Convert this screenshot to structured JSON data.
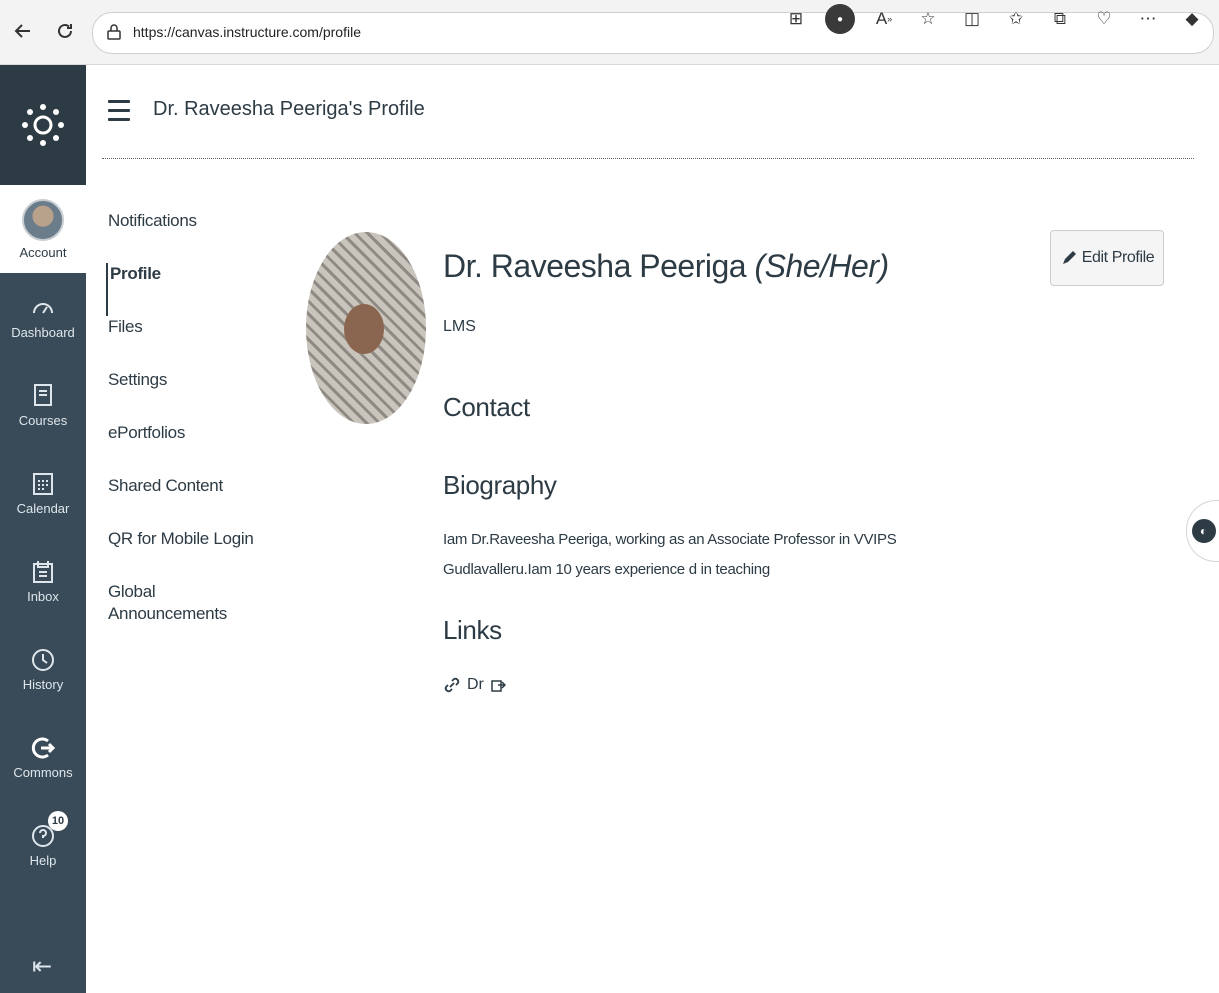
{
  "browser": {
    "url": "https://canvas.instructure.com/profile",
    "toolbar_icons": [
      "grid-icon",
      "avatar-icon",
      "read-aloud-icon",
      "favorite-star-icon",
      "split-screen-icon",
      "favorites-list-icon",
      "collections-icon",
      "browser-essentials-icon",
      "more-icon",
      "copilot-icon"
    ]
  },
  "global_nav": {
    "items": [
      {
        "label": "Account",
        "icon": "account-avatar"
      },
      {
        "label": "Dashboard",
        "icon": "dashboard-icon"
      },
      {
        "label": "Courses",
        "icon": "courses-icon"
      },
      {
        "label": "Calendar",
        "icon": "calendar-icon"
      },
      {
        "label": "Inbox",
        "icon": "inbox-icon"
      },
      {
        "label": "History",
        "icon": "history-icon"
      },
      {
        "label": "Commons",
        "icon": "commons-icon"
      },
      {
        "label": "Help",
        "icon": "help-icon",
        "badge": "10"
      }
    ]
  },
  "header": {
    "title": "Dr. Raveesha Peeriga's Profile"
  },
  "subnav": {
    "items": [
      {
        "label": "Notifications"
      },
      {
        "label": "Profile"
      },
      {
        "label": "Files"
      },
      {
        "label": "Settings"
      },
      {
        "label": "ePortfolios"
      },
      {
        "label": "Shared Content"
      },
      {
        "label": "QR for Mobile Login"
      },
      {
        "label": "Global Announcements"
      }
    ]
  },
  "profile": {
    "name": "Dr. Raveesha Peeriga",
    "pronouns": "(She/Her)",
    "title": "LMS",
    "edit_label": "Edit Profile",
    "contact_heading": "Contact",
    "biography_heading": "Biography",
    "biography_text": "Iam Dr.Raveesha Peeriga, working as an Associate Professor in VVIPS Gudlavalleru.Iam 10 years experience d in teaching",
    "links_heading": "Links",
    "link_label": "Dr"
  },
  "colors": {
    "nav_bg": "#394b58",
    "text": "#2d3b45"
  }
}
